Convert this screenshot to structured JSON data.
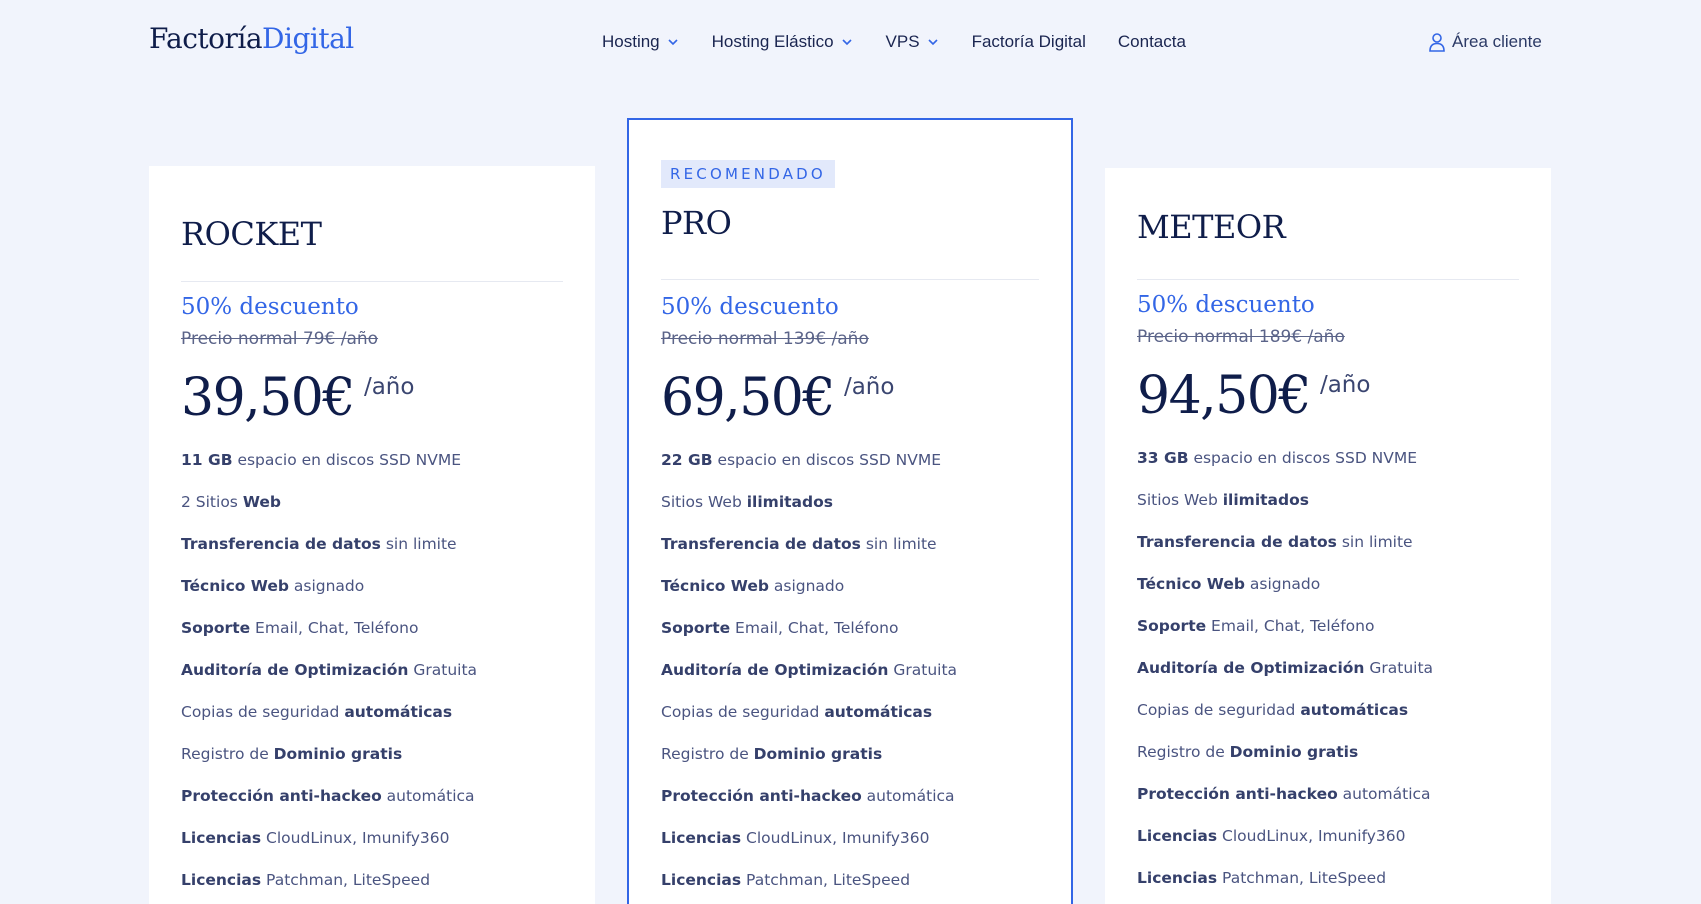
{
  "brand": {
    "part1": "Factoría",
    "part2": "Digital",
    "accent_color": "#3366e6"
  },
  "nav": {
    "items": [
      {
        "label": "Hosting",
        "dropdown": true
      },
      {
        "label": "Hosting Elástico",
        "dropdown": true
      },
      {
        "label": "VPS",
        "dropdown": true
      },
      {
        "label": "Factoría Digital",
        "dropdown": false
      },
      {
        "label": "Contacta",
        "dropdown": false
      }
    ],
    "client_label": "Área cliente",
    "client_icon": "user-icon"
  },
  "plans": [
    {
      "badge": "",
      "name": "ROCKET",
      "discount": "50% descuento",
      "normal_price": "Precio normal 79€ /año",
      "price": "39,50€",
      "per": "/año",
      "features": [
        {
          "a": "11 GB",
          "b": " espacio en discos SSD NVME"
        },
        {
          "a": "2 Sitios ",
          "b": "Web"
        },
        {
          "a": "Transferencia de datos",
          "b": " sin limite"
        },
        {
          "a": "Técnico Web",
          "b": " asignado"
        },
        {
          "a": "Soporte",
          "b": " Email, Chat, Teléfono"
        },
        {
          "a": "Auditoría de Optimización",
          "b": " Gratuita"
        },
        {
          "a": "Copias de seguridad ",
          "b": "automáticas"
        },
        {
          "a": "Registro de ",
          "b": "Dominio gratis"
        },
        {
          "a": "Protección anti-hackeo",
          "b": " automática"
        },
        {
          "a": "Licencias",
          "b": " CloudLinux, Imunify360"
        },
        {
          "a": "Licencias",
          "b": " Patchman, LiteSpeed"
        }
      ]
    },
    {
      "badge": "RECOMENDADO",
      "name": "PRO",
      "discount": "50% descuento",
      "normal_price": "Precio normal 139€ /año",
      "price": "69,50€",
      "per": "/año",
      "features": [
        {
          "a": "22 GB",
          "b": " espacio en discos SSD NVME"
        },
        {
          "a": "Sitios Web ",
          "b": "ilimitados"
        },
        {
          "a": "Transferencia de datos",
          "b": " sin limite"
        },
        {
          "a": "Técnico Web",
          "b": " asignado"
        },
        {
          "a": "Soporte",
          "b": " Email, Chat, Teléfono"
        },
        {
          "a": "Auditoría de Optimización",
          "b": " Gratuita"
        },
        {
          "a": "Copias de seguridad ",
          "b": "automáticas"
        },
        {
          "a": "Registro de ",
          "b": "Dominio gratis"
        },
        {
          "a": "Protección anti-hackeo",
          "b": " automática"
        },
        {
          "a": "Licencias",
          "b": " CloudLinux, Imunify360"
        },
        {
          "a": "Licencias",
          "b": " Patchman, LiteSpeed"
        }
      ]
    },
    {
      "badge": "",
      "name": "METEOR",
      "discount": "50% descuento",
      "normal_price": "Precio normal 189€ /año",
      "price": "94,50€",
      "per": "/año",
      "features": [
        {
          "a": "33 GB",
          "b": " espacio en discos SSD NVME"
        },
        {
          "a": "Sitios Web ",
          "b": "ilimitados"
        },
        {
          "a": "Transferencia de datos",
          "b": " sin limite"
        },
        {
          "a": "Técnico Web",
          "b": " asignado"
        },
        {
          "a": "Soporte",
          "b": " Email, Chat, Teléfono"
        },
        {
          "a": "Auditoría de Optimización",
          "b": " Gratuita"
        },
        {
          "a": "Copias de seguridad ",
          "b": "automáticas"
        },
        {
          "a": "Registro de ",
          "b": "Dominio gratis"
        },
        {
          "a": "Protección anti-hackeo",
          "b": " automática"
        },
        {
          "a": "Licencias",
          "b": " CloudLinux, Imunify360"
        },
        {
          "a": "Licencias",
          "b": " Patchman, LiteSpeed"
        }
      ]
    }
  ],
  "feature_bold_first": [
    [
      true,
      false,
      true,
      true,
      true,
      true,
      false,
      false,
      true,
      true,
      true
    ],
    [
      true,
      false,
      true,
      true,
      true,
      true,
      false,
      false,
      true,
      true,
      true
    ],
    [
      true,
      false,
      true,
      true,
      true,
      true,
      false,
      false,
      true,
      true,
      true
    ]
  ]
}
